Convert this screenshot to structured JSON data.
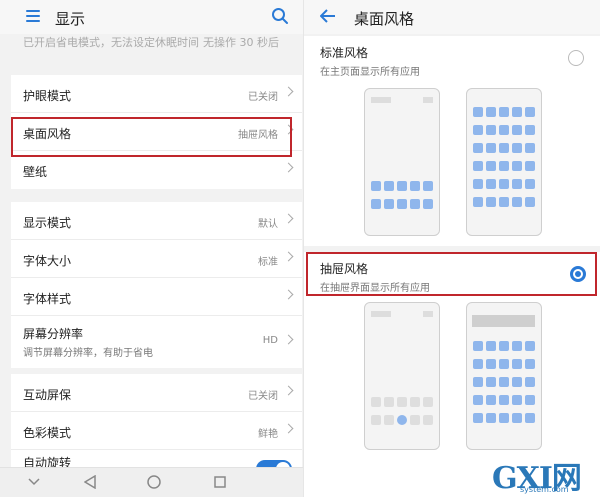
{
  "left": {
    "header": {
      "title": "显示"
    },
    "ghost_text": "已开启省电模式，无法设定休眠时间",
    "ghost_value": "无操作 30 秒后",
    "group1": [
      {
        "label": "护眼模式",
        "value": "已关闭"
      },
      {
        "label": "桌面风格",
        "value": "抽屉风格"
      },
      {
        "label": "壁纸",
        "value": ""
      }
    ],
    "group2": [
      {
        "label": "显示模式",
        "value": "默认"
      },
      {
        "label": "字体大小",
        "value": "标准"
      },
      {
        "label": "字体样式",
        "value": ""
      },
      {
        "label": "屏幕分辨率",
        "sub": "调节屏幕分辨率，有助于省电",
        "value": "HD"
      }
    ],
    "group3": [
      {
        "label": "互动屏保",
        "value": "已关闭"
      },
      {
        "label": "色彩模式",
        "value": "鲜艳"
      },
      {
        "label": "自动旋转",
        "toggle": true
      }
    ]
  },
  "right": {
    "header": {
      "title": "桌面风格"
    },
    "options": [
      {
        "label": "标准风格",
        "sub": "在主页面显示所有应用",
        "selected": false
      },
      {
        "label": "抽屉风格",
        "sub": "在抽屉界面显示所有应用",
        "selected": true
      }
    ]
  },
  "watermark": {
    "big": "GXI网",
    "small": "system.com"
  },
  "colors": {
    "accent": "#2a7ad6",
    "highlight": "#c0262c"
  },
  "icons": [
    "menu-icon",
    "search-icon",
    "back-arrow-icon",
    "chevron-right-icon",
    "nav-back-icon",
    "nav-home-icon",
    "nav-recent-icon",
    "nav-down-icon"
  ]
}
